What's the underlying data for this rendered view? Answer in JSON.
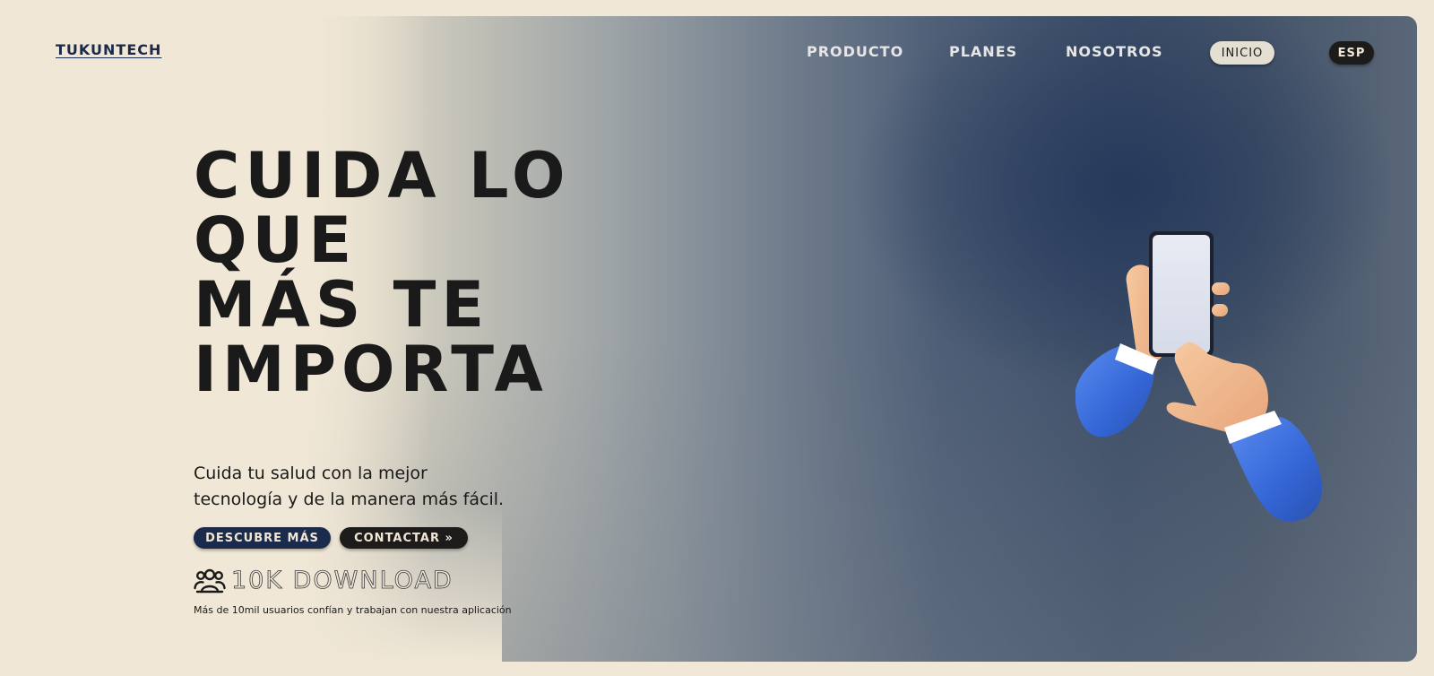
{
  "header": {
    "logo": "TUKUNTECH",
    "nav": {
      "producto": "PRODUCTO",
      "planes": "PLANES",
      "nosotros": "NOSOTROS",
      "inicio": "INICIO",
      "language": "ESP"
    }
  },
  "hero": {
    "headline": [
      "CUIDA LO",
      "QUE",
      "MÁS TE",
      "IMPORTA"
    ],
    "subtitle": [
      "Cuida tu salud con la mejor",
      "tecnología y de la manera más fácil."
    ],
    "buttons": {
      "discover": "DESCUBRE MÁS",
      "contact": "CONTACTAR »"
    },
    "downloads": {
      "count_label": "10K DOWNLOAD",
      "caption": "Más de 10mil usuarios confían y trabajan con nuestra aplicación",
      "icon": "users-icon"
    },
    "illustration": "hands-holding-phone"
  },
  "colors": {
    "background": "#f0e7d6",
    "navy": "#1a2b4c",
    "dark": "#1d1c1b",
    "sleeve_blue": "#3a6fd8"
  }
}
